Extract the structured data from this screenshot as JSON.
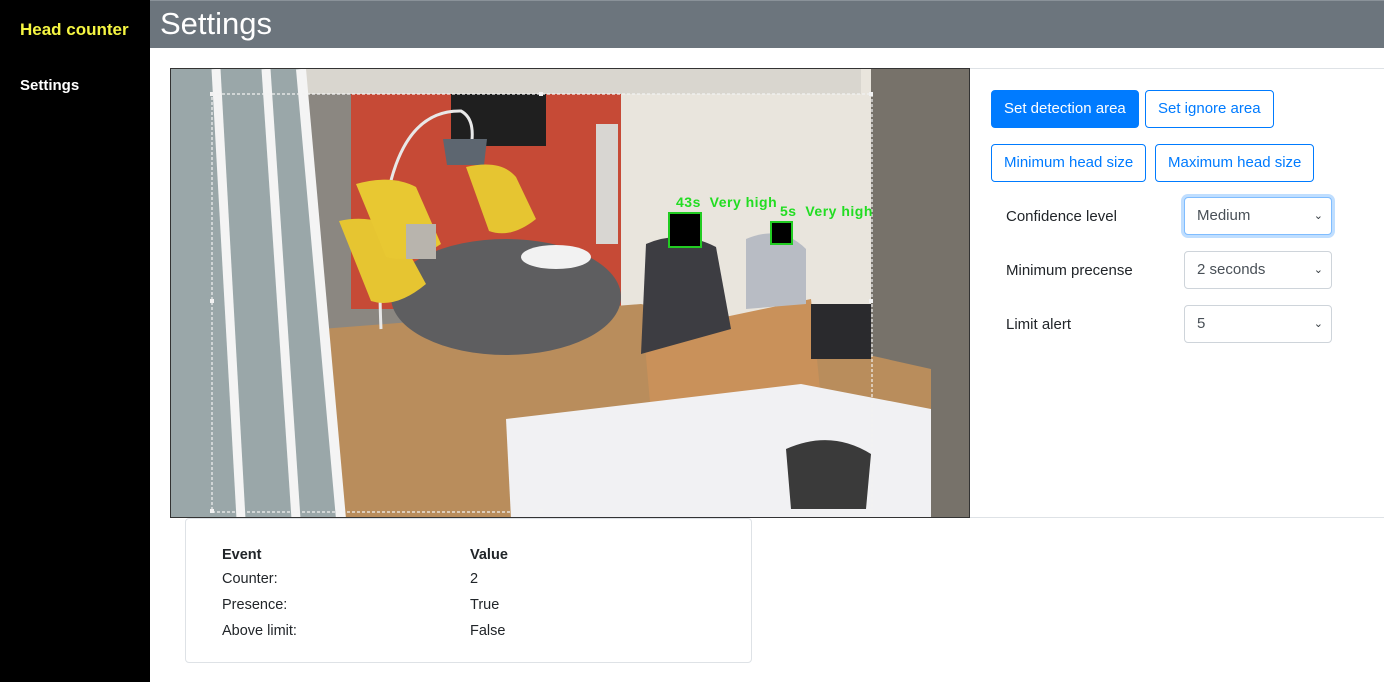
{
  "sidebar": {
    "brand": "Head counter",
    "items": [
      {
        "label": "Settings"
      }
    ]
  },
  "header": {
    "title": "Settings"
  },
  "camera": {
    "detections": [
      {
        "label": "43s  Very high"
      },
      {
        "label": "5s  Very high"
      }
    ]
  },
  "controls": {
    "set_detection_area": "Set detection area",
    "set_ignore_area": "Set ignore area",
    "minimum_head_size": "Minimum head size",
    "maximum_head_size": "Maximum head size",
    "confidence": {
      "label": "Confidence level",
      "value": "Medium"
    },
    "presence": {
      "label": "Minimum precense",
      "value": "2 seconds"
    },
    "limit": {
      "label": "Limit alert",
      "value": "5"
    }
  },
  "events": {
    "headers": [
      "Event",
      "Value"
    ],
    "rows": [
      {
        "event": "Counter:",
        "value": "2"
      },
      {
        "event": "Presence:",
        "value": "True"
      },
      {
        "event": "Above limit:",
        "value": "False"
      }
    ]
  },
  "colors": {
    "sidebar_bg": "#000000",
    "brand": "#f5f542",
    "header_bg": "#6c757d",
    "primary": "#007bff",
    "detection_box": "#22cc22"
  }
}
